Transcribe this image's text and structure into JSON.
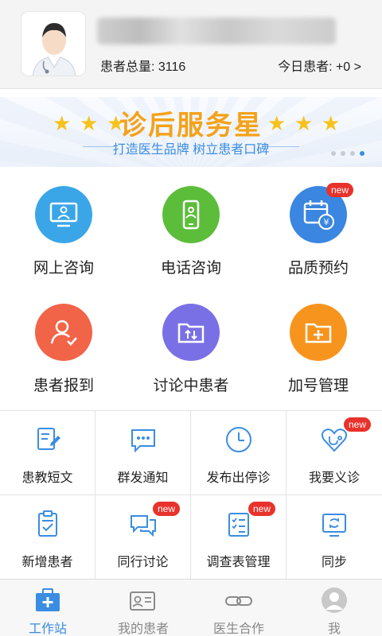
{
  "header": {
    "patient_total_label": "患者总量: 3116",
    "today_patients_label": "今日患者: +0 >"
  },
  "banner": {
    "title": "诊后服务星",
    "subtitle": "打造医生品牌 树立患者口碑"
  },
  "main_features": [
    {
      "label": "网上咨询",
      "color": "#3aa6e8",
      "icon": "monitor-user-icon"
    },
    {
      "label": "电话咨询",
      "color": "#5cbd3a",
      "icon": "phone-icon"
    },
    {
      "label": "品质预约",
      "color": "#3a86e0",
      "icon": "calendar-yen-icon",
      "badge": "new"
    },
    {
      "label": "患者报到",
      "color": "#f26448",
      "icon": "user-check-icon"
    },
    {
      "label": "讨论中患者",
      "color": "#7a70e6",
      "icon": "folder-transfer-icon"
    },
    {
      "label": "加号管理",
      "color": "#f7941e",
      "icon": "folder-plus-icon"
    }
  ],
  "tools": [
    {
      "label": "患教短文",
      "icon": "document-edit-icon"
    },
    {
      "label": "群发通知",
      "icon": "chat-dots-icon"
    },
    {
      "label": "发布出停诊",
      "icon": "clock-icon"
    },
    {
      "label": "我要义诊",
      "icon": "heart-stethoscope-icon",
      "badge": "new"
    },
    {
      "label": "新增患者",
      "icon": "clipboard-check-icon"
    },
    {
      "label": "同行讨论",
      "icon": "chat-bubbles-icon",
      "badge": "new"
    },
    {
      "label": "调查表管理",
      "icon": "checklist-icon",
      "badge": "new"
    },
    {
      "label": "同步",
      "icon": "sync-device-icon"
    }
  ],
  "tabs": [
    {
      "label": "工作站",
      "icon": "medical-kit-icon",
      "active": true
    },
    {
      "label": "我的患者",
      "icon": "patient-card-icon",
      "active": false
    },
    {
      "label": "医生合作",
      "icon": "link-icon",
      "active": false
    },
    {
      "label": "我",
      "icon": "profile-icon",
      "active": false
    }
  ],
  "colors": {
    "accent": "#3a8de2",
    "badge": "#e8322b",
    "banner_title": "#f4a21a"
  }
}
